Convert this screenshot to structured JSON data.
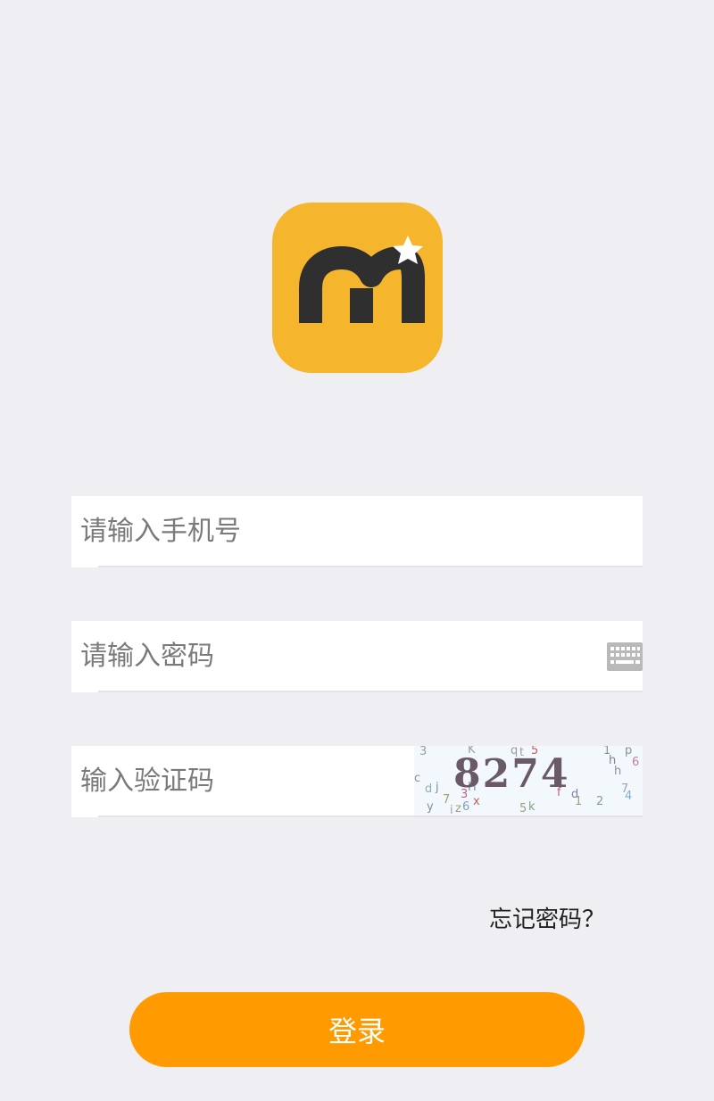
{
  "app": {
    "logo_icon": "app-logo-m-star-icon",
    "brand_color": "#f5b62d"
  },
  "form": {
    "phone_placeholder": "请输入手机号",
    "password_placeholder": "请输入密码",
    "password_toggle_icon": "keyboard-icon",
    "captcha_placeholder": "输入验证码",
    "captcha_code": "8274"
  },
  "links": {
    "forgot_password": "忘记密码？"
  },
  "actions": {
    "login_label": "登录",
    "login_color": "#ff9a00"
  }
}
